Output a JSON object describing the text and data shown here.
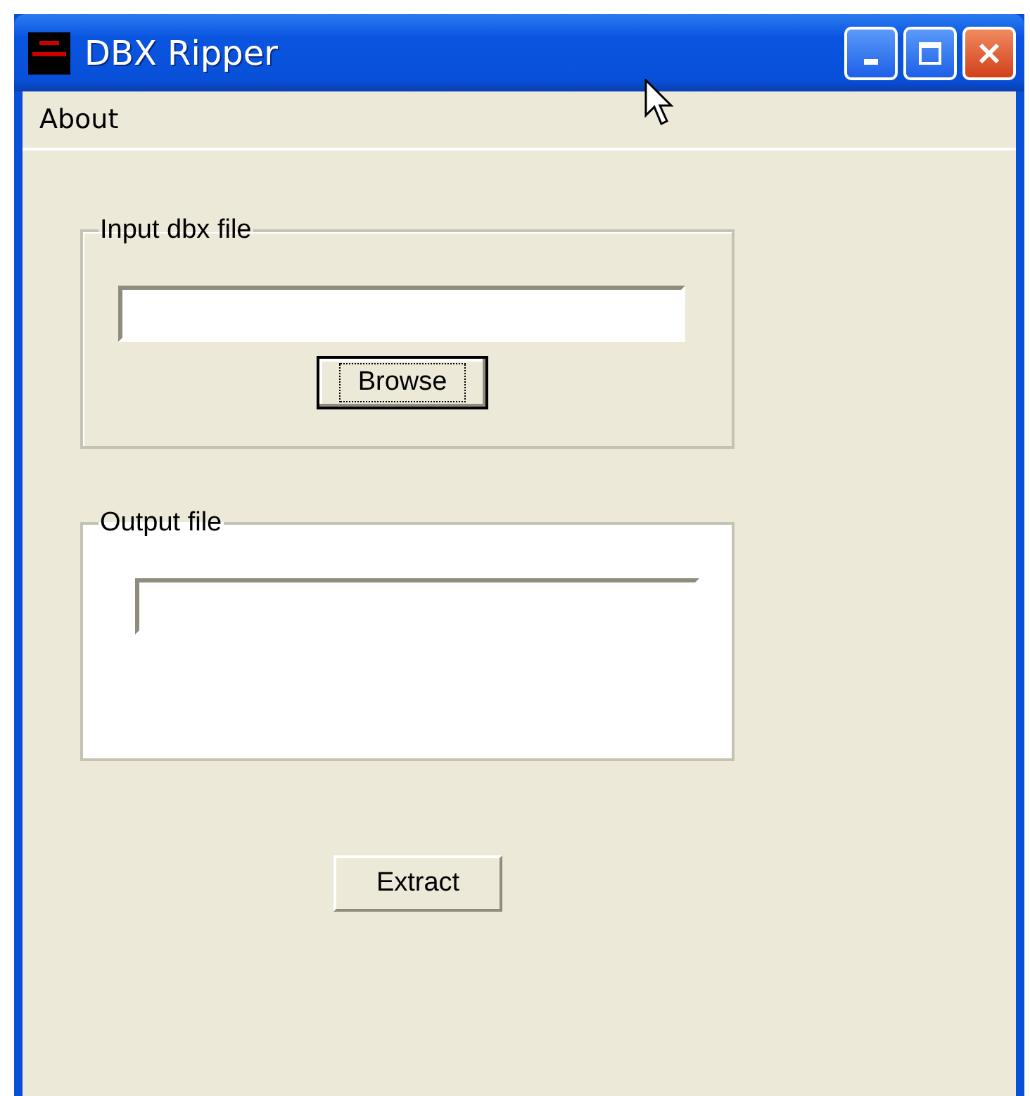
{
  "window": {
    "title": "DBX Ripper"
  },
  "menu": [
    "About"
  ],
  "groups": [
    {
      "label": "Input dbx file",
      "highlighted": false,
      "button": {
        "label": "Browse",
        "focused": true
      }
    },
    {
      "label": "Output file",
      "highlighted": true
    }
  ],
  "extract_button": {
    "label": "Extract",
    "focused": false
  }
}
